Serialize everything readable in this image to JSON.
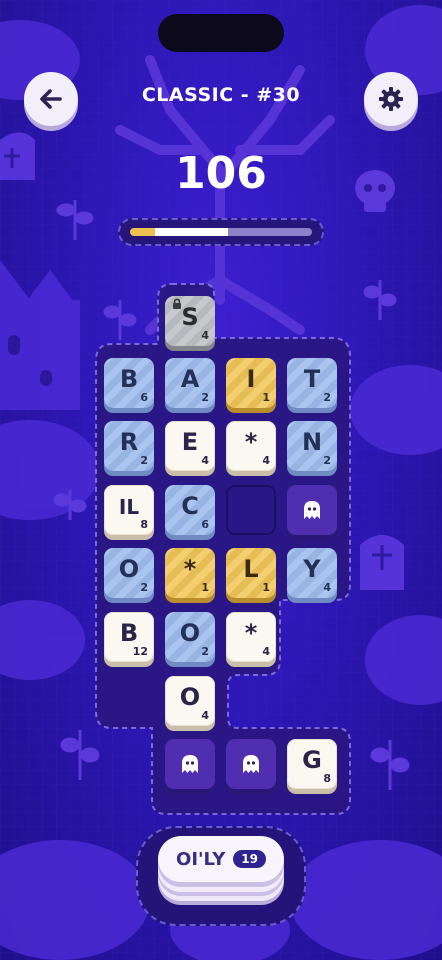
{
  "header": {
    "title": "CLASSIC - #30",
    "back_icon": "arrow-left-icon",
    "settings_icon": "gear-icon"
  },
  "score": "106",
  "progress": {
    "gold_fraction": 0.14,
    "white_fraction": 0.54
  },
  "colors": {
    "accent_gold": "#f0c050",
    "tile_white": "#fbf8f2",
    "tile_blue": "#a9c4ee",
    "tile_gold": "#f3cf6f",
    "background": "#2d17b5"
  },
  "board": {
    "rows": [
      [
        {
          "type": "empty-slot"
        },
        {
          "type": "grey",
          "letter": "S",
          "points": "4",
          "locked": true
        },
        {
          "type": "empty-slot"
        },
        {
          "type": "empty-slot"
        }
      ],
      [
        {
          "type": "blue",
          "letter": "B",
          "points": "6"
        },
        {
          "type": "blue",
          "letter": "A",
          "points": "2"
        },
        {
          "type": "gold",
          "letter": "I",
          "points": "1"
        },
        {
          "type": "blue",
          "letter": "T",
          "points": "2"
        }
      ],
      [
        {
          "type": "blue",
          "letter": "R",
          "points": "2"
        },
        {
          "type": "white",
          "letter": "E",
          "points": "4"
        },
        {
          "type": "white",
          "letter": "*",
          "points": "4"
        },
        {
          "type": "blue",
          "letter": "N",
          "points": "2"
        }
      ],
      [
        {
          "type": "white",
          "letter": "IL",
          "points": "8"
        },
        {
          "type": "blue",
          "letter": "C",
          "points": "6"
        },
        {
          "type": "hole"
        },
        {
          "type": "ghost"
        }
      ],
      [
        {
          "type": "blue",
          "letter": "O",
          "points": "2"
        },
        {
          "type": "gold",
          "letter": "*",
          "points": "1"
        },
        {
          "type": "gold",
          "letter": "L",
          "points": "1"
        },
        {
          "type": "blue",
          "letter": "Y",
          "points": "4"
        }
      ],
      [
        {
          "type": "white",
          "letter": "B",
          "points": "12"
        },
        {
          "type": "blue",
          "letter": "O",
          "points": "2"
        },
        {
          "type": "white",
          "letter": "*",
          "points": "4"
        },
        {
          "type": "empty-slot"
        }
      ],
      [
        {
          "type": "empty-slot"
        },
        {
          "type": "white",
          "letter": "O",
          "points": "4"
        },
        {
          "type": "empty-slot"
        },
        {
          "type": "empty-slot"
        }
      ],
      [
        {
          "type": "empty-slot"
        },
        {
          "type": "ghost"
        },
        {
          "type": "ghost"
        },
        {
          "type": "white",
          "letter": "G",
          "points": "8"
        }
      ]
    ]
  },
  "current_word": {
    "label": "OI'LY",
    "score": "19"
  }
}
